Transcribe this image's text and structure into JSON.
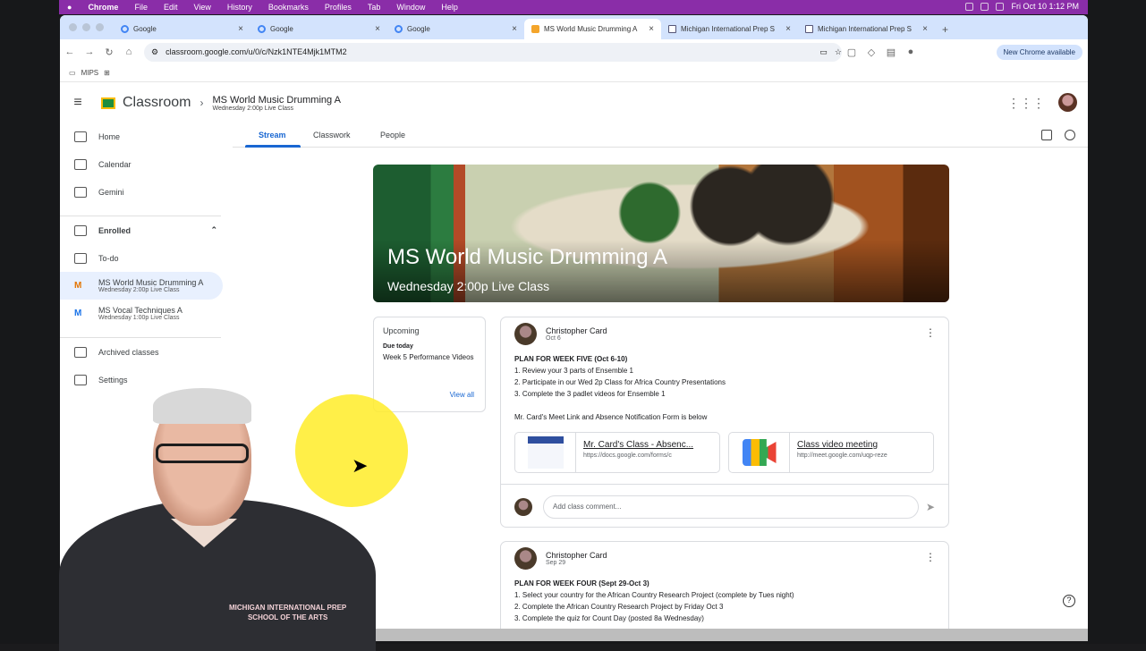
{
  "mac_menu": {
    "apple": "",
    "app": "Chrome",
    "items": [
      "File",
      "Edit",
      "View",
      "History",
      "Bookmarks",
      "Profiles",
      "Tab",
      "Window",
      "Help"
    ],
    "clock": "Fri Oct 10  1:12 PM"
  },
  "tabs": [
    {
      "label": "Google",
      "icon": "google-icon"
    },
    {
      "label": "Google",
      "icon": "google-icon"
    },
    {
      "label": "Google",
      "icon": "google-icon"
    },
    {
      "label": "MS World Music Drumming A",
      "icon": "classroom-icon",
      "active": true
    },
    {
      "label": "Michigan International Prep S",
      "icon": "doc-icon"
    },
    {
      "label": "Michigan International Prep S",
      "icon": "doc-icon"
    }
  ],
  "address": {
    "url": "classroom.google.com/u/0/c/Nzk1NTE4Mjk1MTM2",
    "new_chrome": "New Chrome available"
  },
  "bookmarks": {
    "folder": "MIPS"
  },
  "header": {
    "brand": "Classroom",
    "class_title": "MS World Music Drumming A",
    "class_sub": "Wednesday 2:00p Live Class"
  },
  "sidebar": {
    "home": "Home",
    "calendar": "Calendar",
    "gemini": "Gemini",
    "enrolled": "Enrolled",
    "todo": "To-do",
    "classes": [
      {
        "letter": "M",
        "name": "MS World Music Drumming A",
        "sub": "Wednesday 2:00p Live Class"
      },
      {
        "letter": "M",
        "name": "MS Vocal Techniques A",
        "sub": "Wednesday 1:00p Live Class"
      }
    ],
    "archived": "Archived classes",
    "settings": "Settings"
  },
  "class_tabs": {
    "stream": "Stream",
    "classwork": "Classwork",
    "people": "People"
  },
  "banner": {
    "title": "MS World Music Drumming A",
    "subtitle": "Wednesday 2:00p Live Class"
  },
  "upcoming": {
    "title": "Upcoming",
    "due": "Due today",
    "item": "Week 5 Performance Videos",
    "view_all": "View all"
  },
  "posts": [
    {
      "author": "Christopher Card",
      "date": "Oct 6",
      "title": "PLAN FOR WEEK FIVE (Oct 6-10)",
      "lines": [
        "1.  Review your 3 parts of Ensemble 1",
        "2.  Participate in our Wed 2p Class for Africa Country Presentations",
        "3.  Complete the 3 padlet videos for Ensemble 1"
      ],
      "note": "Mr. Card's Meet Link and Absence Notification Form is below",
      "att1_title": "Mr. Card's Class - Absenc...",
      "att1_url": "https://docs.google.com/forms/c",
      "att2_title": "Class video meeting",
      "att2_url": "http://meet.google.com/uqp-reze",
      "comment_placeholder": "Add class comment..."
    },
    {
      "author": "Christopher Card",
      "date": "Sep 29",
      "title": "PLAN FOR WEEK FOUR (Sept 29-Oct 3)",
      "lines": [
        "1.  Select your country for the African Country Research Project (complete by Tues night)",
        "2.  Complete the African Country Research Project by Friday Oct 3",
        "3.  Complete the quiz for Count Day (posted 8a Wednesday)"
      ]
    }
  ],
  "overlay": {
    "logo_text": "MICHIGAN INTERNATIONAL PREP",
    "logo_sub": "SCHOOL OF THE ARTS"
  }
}
